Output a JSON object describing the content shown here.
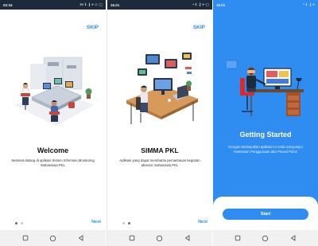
{
  "colors": {
    "accent": "#2e8df0",
    "panel_blue": "#2f8cf0",
    "status_dark": "#1c2a3a"
  },
  "screens": [
    {
      "status": {
        "time": "02:34",
        "icons": "⋈ ℹ .∥ ⌖ ◇ ▢"
      },
      "skip_label": "SKIP",
      "title": "Welcome",
      "description": "Selamat datang di aplikasi Sistem Informasi Monitoring Mahasiswa PKL",
      "next_label": "Next"
    },
    {
      "status": {
        "time": "16.01",
        "icons": "• ℹ .∥ ⌖ ▢"
      },
      "skip_label": "SKIP",
      "title": "SIMMA PKL",
      "description": "Aplikasi yang dapat membantu pemantauan kegiatan absensi mahasiswa PKL",
      "next_label": "Next"
    },
    {
      "status": {
        "time": "16.01",
        "icons": "• ℹ .∥ ⌖"
      },
      "title": "Getting Started",
      "description": "Dengan Melanjutkan aplikasi ini Anda menyetujui Ketentuan Penggunaan dan Privasi Poinz",
      "start_label": "Start"
    }
  ]
}
